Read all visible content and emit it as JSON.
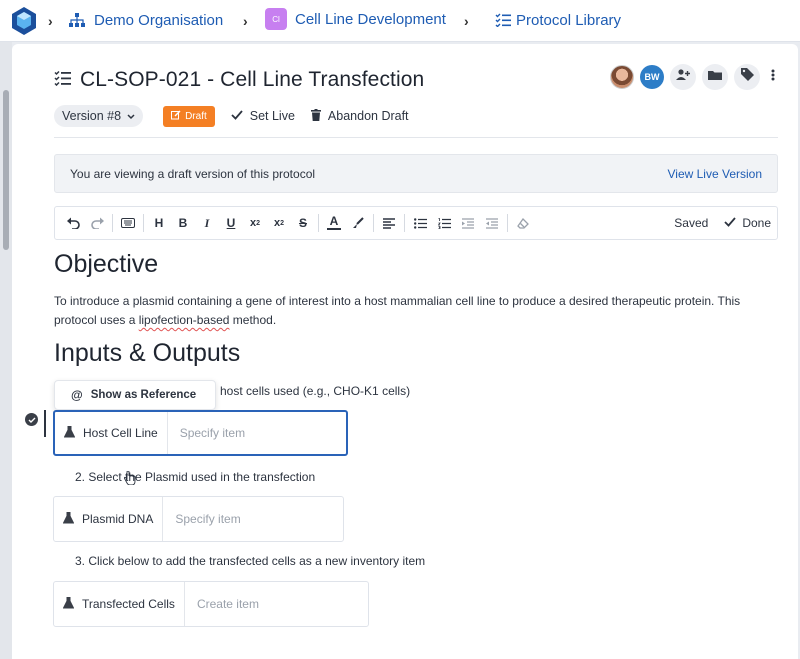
{
  "nav": {
    "org": "Demo Organisation",
    "project_badge": "Cl",
    "project": "Cell Line Development",
    "library": "Protocol Library"
  },
  "protocol": {
    "title": "CL-SOP-021 - Cell Line Transfection",
    "version": "Version #8",
    "draft_label": "Draft",
    "set_live": "Set Live",
    "abandon": "Abandon Draft",
    "avatar_initials": "BW"
  },
  "banner": {
    "message": "You are viewing a draft version of this protocol",
    "link": "View Live Version"
  },
  "editor": {
    "status": "Saved",
    "done": "Done"
  },
  "content": {
    "objective_heading": "Objective",
    "objective_text_1": "To introduce a plasmid containing a gene of interest into a host mammalian cell line to produce a desired therapeutic protein. This protocol uses a ",
    "objective_text_squiggle": "lipofection-based",
    "objective_text_2": " method.",
    "io_heading": "Inputs & Outputs",
    "step1_partial": "host cells used (e.g., CHO-K1 cells)",
    "reference_popup": "Show as Reference",
    "item1_label": "Host Cell Line",
    "item1_placeholder": "Specify item",
    "step2": "2. Select the Plasmid used in the transfection",
    "item2_label": "Plasmid DNA",
    "item2_placeholder": "Specify item",
    "step3": "3. Click below to add the transfected cells as a new inventory item",
    "item3_label": "Transfected Cells",
    "item3_placeholder": "Create item"
  },
  "colors": {
    "accent": "#1e5cb3",
    "draft": "#f47f24",
    "badge": "#c77ff0",
    "active_border": "#2a63b8"
  }
}
